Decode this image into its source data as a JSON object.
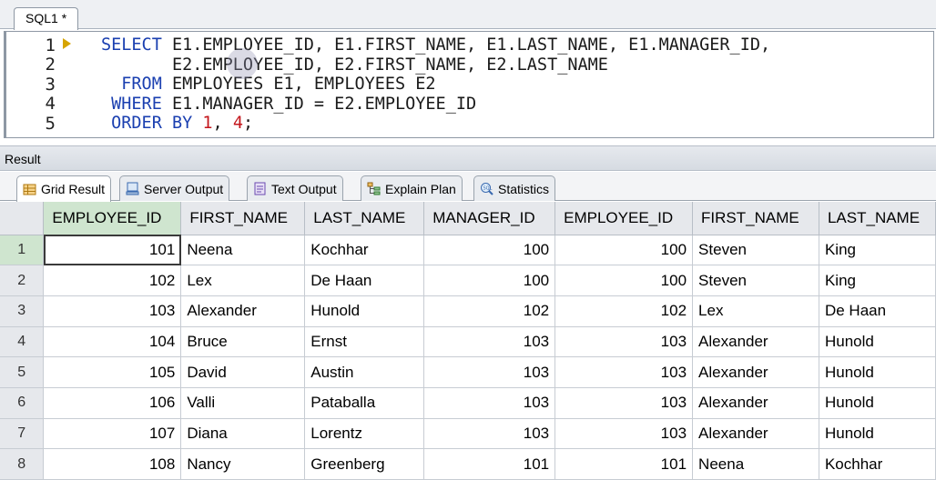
{
  "document_tab": {
    "label": "SQL1 *"
  },
  "editor": {
    "line_numbers": [
      "1",
      "2",
      "3",
      "4",
      "5"
    ],
    "lines": [
      [
        {
          "t": "SELECT ",
          "k": "kw"
        },
        {
          "t": "E1.EMPLOYEE_ID, E1.FIRST_NAME, E1.LAST_NAME, E1.MANAGER_ID,",
          "k": ""
        }
      ],
      [
        {
          "t": "       E2.EMPLOYEE_ID, E2.FIRST_NAME, E2.LAST_NAME",
          "k": ""
        }
      ],
      [
        {
          "t": "  FROM ",
          "k": "kw"
        },
        {
          "t": "EMPLOYEES E1, EMPLOYEES E2",
          "k": ""
        }
      ],
      [
        {
          "t": " WHERE ",
          "k": "kw"
        },
        {
          "t": "E1.MANAGER_ID = E2.EMPLOYEE_ID",
          "k": ""
        }
      ],
      [
        {
          "t": " ORDER BY ",
          "k": "kw"
        },
        {
          "t": "1",
          "k": "num"
        },
        {
          "t": ", ",
          "k": ""
        },
        {
          "t": "4",
          "k": "num"
        },
        {
          "t": ";",
          "k": ""
        }
      ]
    ]
  },
  "result_panel": {
    "title": "Result"
  },
  "result_tabs": [
    {
      "label": "Grid Result",
      "icon": "grid-icon",
      "active": true
    },
    {
      "label": "Server Output",
      "icon": "server-output-icon",
      "active": false
    },
    {
      "label": "Text Output",
      "icon": "text-output-icon",
      "active": false
    },
    {
      "label": "Explain Plan",
      "icon": "explain-plan-icon",
      "active": false
    },
    {
      "label": "Statistics",
      "icon": "statistics-icon",
      "active": false
    }
  ],
  "grid": {
    "columns": [
      "EMPLOYEE_ID",
      "FIRST_NAME",
      "LAST_NAME",
      "MANAGER_ID",
      "EMPLOYEE_ID",
      "FIRST_NAME",
      "LAST_NAME"
    ],
    "numeric_columns": [
      0,
      3,
      4
    ],
    "rows": [
      {
        "n": "1",
        "cells": [
          "101",
          "Neena",
          "Kochhar",
          "100",
          "100",
          "Steven",
          "King"
        ]
      },
      {
        "n": "2",
        "cells": [
          "102",
          "Lex",
          "De  Haan",
          "100",
          "100",
          "Steven",
          "King"
        ]
      },
      {
        "n": "3",
        "cells": [
          "103",
          "Alexander",
          "Hunold",
          "102",
          "102",
          "Lex",
          "De  Haan"
        ]
      },
      {
        "n": "4",
        "cells": [
          "104",
          "Bruce",
          "Ernst",
          "103",
          "103",
          "Alexander",
          "Hunold"
        ]
      },
      {
        "n": "5",
        "cells": [
          "105",
          "David",
          "Austin",
          "103",
          "103",
          "Alexander",
          "Hunold"
        ]
      },
      {
        "n": "6",
        "cells": [
          "106",
          "Valli",
          "Pataballa",
          "103",
          "103",
          "Alexander",
          "Hunold"
        ]
      },
      {
        "n": "7",
        "cells": [
          "107",
          "Diana",
          "Lorentz",
          "103",
          "103",
          "Alexander",
          "Hunold"
        ]
      },
      {
        "n": "8",
        "cells": [
          "108",
          "Nancy",
          "Greenberg",
          "101",
          "101",
          "Neena",
          "Kochhar"
        ]
      }
    ],
    "selected_row": 0,
    "selected_column": 0
  }
}
